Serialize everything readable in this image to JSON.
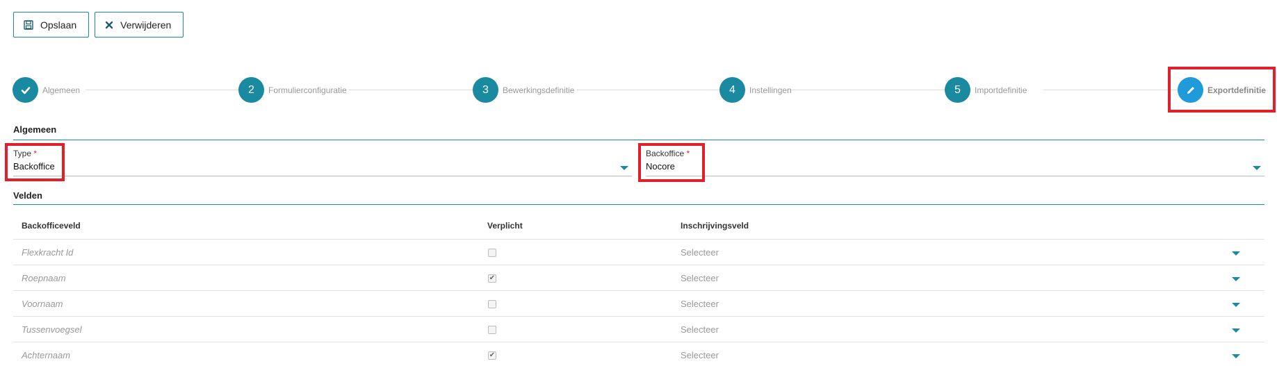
{
  "toolbar": {
    "save_label": "Opslaan",
    "delete_label": "Verwijderen"
  },
  "stepper": {
    "steps": [
      {
        "label": "Algemeen",
        "marker": "✓",
        "state": "done"
      },
      {
        "label": "Formulierconfiguratie",
        "marker": "2",
        "state": "todo"
      },
      {
        "label": "Bewerkingsdefinitie",
        "marker": "3",
        "state": "todo"
      },
      {
        "label": "Instellingen",
        "marker": "4",
        "state": "todo"
      },
      {
        "label": "Importdefinitie",
        "marker": "5",
        "state": "todo"
      },
      {
        "label": "Exportdefinitie",
        "marker": "pencil-icon",
        "state": "active"
      }
    ]
  },
  "general": {
    "title": "Algemeen",
    "type_label": "Type",
    "type_required": "*",
    "type_value": "Backoffice",
    "backoffice_label": "Backoffice",
    "backoffice_required": "*",
    "backoffice_value": "Nocore"
  },
  "fields": {
    "title": "Velden",
    "columns": [
      "Backofficeveld",
      "Verplicht",
      "Inschrijvingsveld"
    ],
    "rows": [
      {
        "name": "Flexkracht Id",
        "required": false,
        "mapping": "Selecteer"
      },
      {
        "name": "Roepnaam",
        "required": true,
        "mapping": "Selecteer"
      },
      {
        "name": "Voornaam",
        "required": false,
        "mapping": "Selecteer"
      },
      {
        "name": "Tussenvoegsel",
        "required": false,
        "mapping": "Selecteer"
      },
      {
        "name": "Achternaam",
        "required": true,
        "mapping": "Selecteer"
      }
    ]
  },
  "colors": {
    "accent": "#1a8aa0",
    "active_step": "#1e9bd8",
    "highlight": "#e0202a"
  }
}
